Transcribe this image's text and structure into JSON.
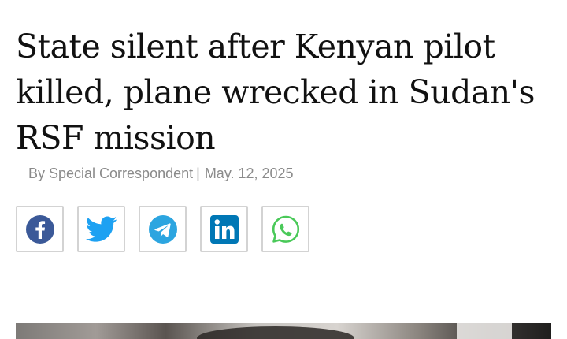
{
  "article": {
    "headline_lines": [
      "State silent after Kenyan pilot",
      "killed, plane wrecked in Sudan's",
      "RSF mission"
    ],
    "byline": {
      "author": "By Special Correspondent",
      "separator": "|",
      "date": "May. 12, 2025"
    }
  },
  "share": {
    "buttons": [
      {
        "name": "facebook",
        "icon": "facebook-icon",
        "color": "#3b5998"
      },
      {
        "name": "twitter",
        "icon": "twitter-icon",
        "color": "#1da1f2"
      },
      {
        "name": "telegram",
        "icon": "telegram-icon",
        "color": "#2ca5e0"
      },
      {
        "name": "linkedin",
        "icon": "linkedin-icon",
        "color": "#0077b5"
      },
      {
        "name": "whatsapp",
        "icon": "whatsapp-icon",
        "color": "#4ac959"
      }
    ]
  }
}
